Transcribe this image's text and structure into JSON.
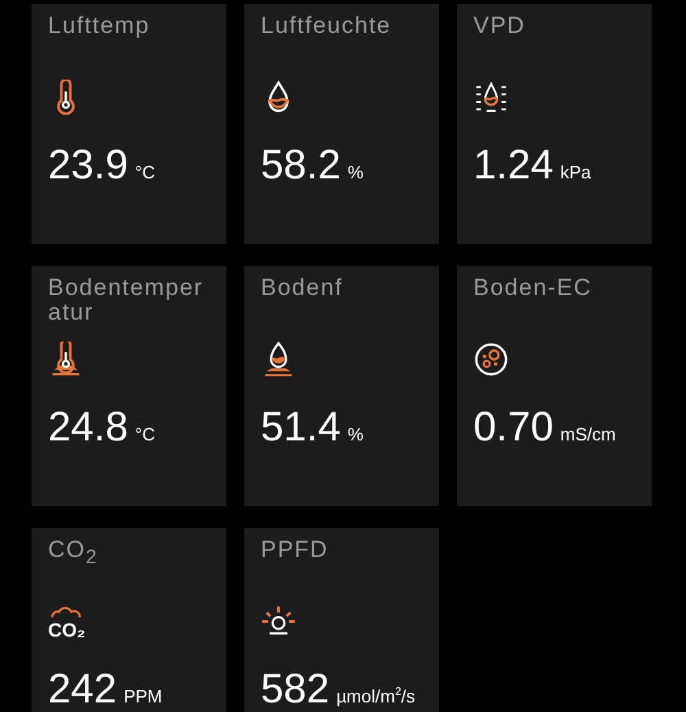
{
  "sensors": [
    {
      "title": "Lufttemp",
      "value": "23.9",
      "unit": "°C"
    },
    {
      "title": "Luftfeuchte",
      "value": "58.2",
      "unit": "%"
    },
    {
      "title": "VPD",
      "value": "1.24",
      "unit": "kPa"
    },
    {
      "title": "Bodentemperatur",
      "value": "24.8",
      "unit": "°C"
    },
    {
      "title": "Bodenf",
      "value": "51.4",
      "unit": "%"
    },
    {
      "title": "Boden-EC",
      "value": "0.70",
      "unit": "mS/cm"
    },
    {
      "title": "CO$_{2}$",
      "icon_text": "CO₂",
      "value": "242",
      "unit": "PPM"
    },
    {
      "title": "PPFD",
      "value": "582",
      "unit": "µmol/m$^{2}$/s"
    }
  ]
}
